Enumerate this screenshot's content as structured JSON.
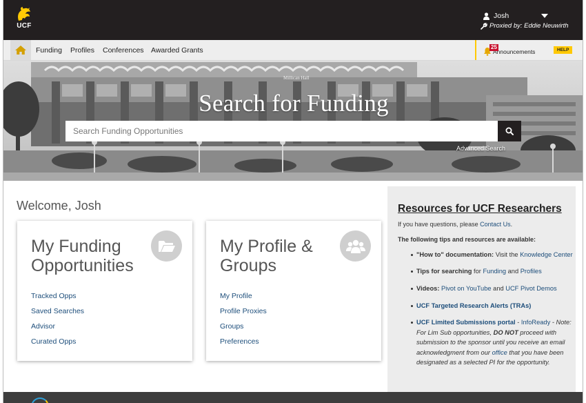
{
  "header": {
    "logo_text": "UCF",
    "user_name": "Josh",
    "proxy_text": "Proxied by: Eddie Neuwirth"
  },
  "nav": {
    "items": [
      "Funding",
      "Profiles",
      "Conferences",
      "Awarded Grants"
    ],
    "announcements_count": "25",
    "announcements_label": "Announcements",
    "help_label": "HELP"
  },
  "hero": {
    "title": "Search for Funding",
    "search_placeholder": "Search Funding Opportunities",
    "advanced_search": "Advanced Search",
    "building_sign": "Millican Hall"
  },
  "welcome": "Welcome, Josh",
  "cards": [
    {
      "title": "My Funding Opportunities",
      "icon": "folder-open-icon",
      "links": [
        "Tracked Opps",
        "Saved Searches",
        "Advisor",
        "Curated Opps"
      ]
    },
    {
      "title": "My Profile & Groups",
      "icon": "users-icon",
      "links": [
        "My Profile",
        "Profile Proxies",
        "Groups",
        "Preferences"
      ]
    }
  ],
  "resources": {
    "title": "Resources for UCF Researchers",
    "questions_prefix": "If you have questions, please ",
    "questions_link": "Contact Us",
    "questions_suffix": ".",
    "tips_intro": "The following tips and resources are available:",
    "howto_label": "\"How to\" documentation:",
    "howto_text": " Visit the ",
    "howto_link": "Knowledge Center",
    "tips_label": "Tips for searching",
    "tips_for": " for ",
    "tips_link1": "Funding",
    "tips_and": " and ",
    "tips_link2": "Profiles",
    "videos_label": "Videos:",
    "videos_link1": "Pivot on YouTube",
    "videos_and": " and ",
    "videos_link2": "UCF Pivot Demos",
    "tra_link": "UCF Targeted Research Alerts (TRAs)",
    "lim_link": "UCF Limited Submissions portal",
    "lim_dash": " - ",
    "lim_link2": "InfoReady",
    "lim_note1": " - Note: For Lim Sub opportunities, ",
    "lim_donot": "DO NOT",
    "lim_note2": " proceed with submission to the sponsor until you receive an email acknowledgment from our ",
    "lim_office": "office",
    "lim_note3": " that you have been designated as a selected PI for the opportunity."
  },
  "colors": {
    "ucf_gold": "#ffc904",
    "ucf_black": "#231f20",
    "link_blue": "#1c4d7a",
    "badge_red": "#c8102e"
  }
}
